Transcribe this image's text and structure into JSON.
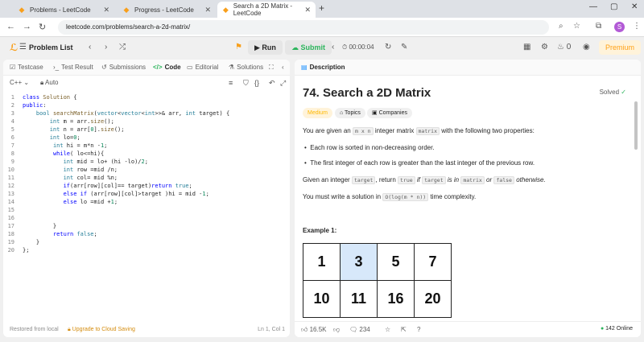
{
  "browser": {
    "tabs": [
      {
        "title": "Problems - LeetCode",
        "active": false
      },
      {
        "title": "Progress - LeetCode",
        "active": false
      },
      {
        "title": "Search a 2D Matrix - LeetCode",
        "active": true
      }
    ],
    "url": "leetcode.com/problems/search-a-2d-matrix/"
  },
  "topbar": {
    "problem_list": "Problem List",
    "run": "Run",
    "submit": "Submit",
    "timer": "00:00:04",
    "streak": "0",
    "premium": "Premium",
    "avatar_letter": "S"
  },
  "left_tabs": [
    "Testcase",
    "Test Result",
    "Submissions",
    "Code",
    "Editorial",
    "Solutions"
  ],
  "editor": {
    "language": "C++",
    "mode": "Auto",
    "lines": [
      "class Solution {",
      "public:",
      "    bool searchMatrix(vector<vector<int>>& arr, int target) {",
      "        int m = arr.size();",
      "        int n = arr[0].size();",
      "        int lo=0;",
      "         int hi = m*n -1;",
      "         while( lo<=hi){",
      "            int mid = lo+ (hi -lo)/2;",
      "            int row =mid /n;",
      "            int col= mid %n;",
      "            if(arr[row][col]== target)return true;",
      "            else if (arr[row][col]>target )hi = mid -1;",
      "            else lo =mid +1;",
      "",
      "",
      "         }",
      "         return false;",
      "    }",
      "};"
    ],
    "footer_left": "Restored from local",
    "footer_upgrade": "Upgrade to Cloud Saving",
    "footer_right": "Ln 1, Col 1"
  },
  "description": {
    "tab": "Description",
    "title": "74. Search a 2D Matrix",
    "solved": "Solved",
    "tags": [
      "Medium",
      "Topics",
      "Companies"
    ],
    "p1_a": "You are given an",
    "p1_code1": "m x n",
    "p1_b": "integer matrix",
    "p1_code2": "matrix",
    "p1_c": "with the following two properties:",
    "bullets": [
      "Each row is sorted in non-decreasing order.",
      "The first integer of each row is greater than the last integer of the previous row."
    ],
    "p2_a": "Given an integer",
    "p2_code1": "target",
    "p2_b": ", return",
    "p2_code2": "true",
    "p2_c": "if",
    "p2_code3": "target",
    "p2_d": "is in",
    "p2_code4": "matrix",
    "p2_e": "or",
    "p2_code5": "false",
    "p2_f": "otherwise.",
    "p3_a": "You must write a solution in",
    "p3_code": "O(log(m * n))",
    "p3_b": "time complexity.",
    "example_label": "Example 1:",
    "matrix": [
      [
        "1",
        "3",
        "5",
        "7"
      ],
      [
        "10",
        "11",
        "16",
        "20"
      ]
    ],
    "footer": {
      "likes": "16.5K",
      "comments": "234",
      "online": "142 Online"
    }
  }
}
